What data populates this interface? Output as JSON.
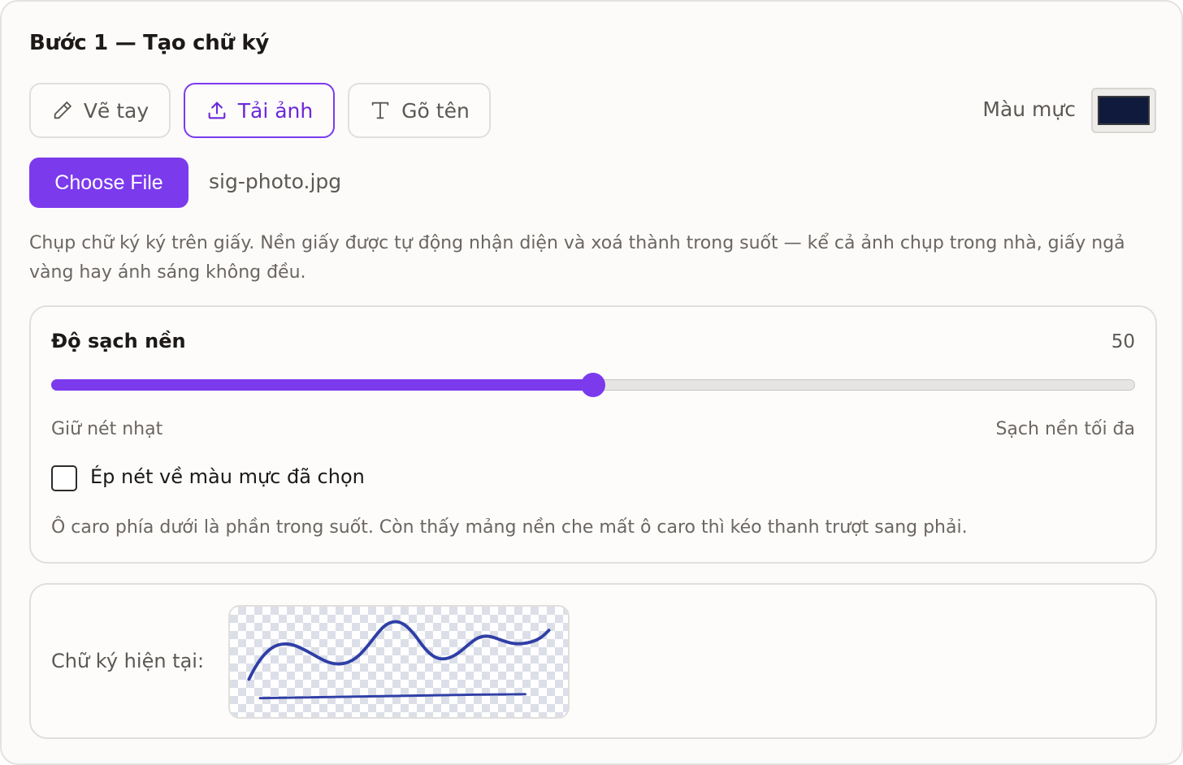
{
  "step": {
    "title": "Bước 1 — Tạo chữ ký"
  },
  "tabs": [
    {
      "label": "Vẽ tay",
      "icon": "pencil-icon"
    },
    {
      "label": "Tải ảnh",
      "icon": "upload-icon"
    },
    {
      "label": "Gõ tên",
      "icon": "text-icon"
    }
  ],
  "active_tab": "Tải ảnh",
  "ink": {
    "label": "Màu mực",
    "color": "#0f1a3d"
  },
  "upload": {
    "button_label": "Choose File",
    "file_name": "sig-photo.jpg"
  },
  "description": "Chụp chữ ký ký trên giấy. Nền giấy được tự động nhận diện và xoá thành trong suốt — kể cả ảnh chụp trong nhà, giấy ngả vàng hay ánh sáng không đều.",
  "cleanliness": {
    "label": "Độ sạch nền",
    "value": "50",
    "fill_percent": 50,
    "min_label": "Giữ nét nhạt",
    "max_label": "Sạch nền tối đa",
    "checkbox_label": "Ép nét về màu mực đã chọn",
    "checkbox_checked": false,
    "hint": "Ô caro phía dưới là phần trong suốt. Còn thấy mảng nền che mất ô caro thì kéo thanh trượt sang phải."
  },
  "current_signature": {
    "label": "Chữ ký hiện tại:",
    "stroke_color": "#2f3fa6"
  },
  "colors": {
    "accent": "#7c3aed",
    "checker": "#dcdfe8"
  }
}
